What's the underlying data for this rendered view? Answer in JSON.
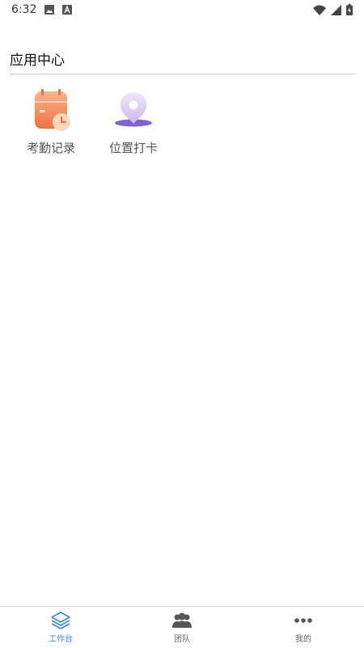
{
  "status_bar": {
    "time": "6:32",
    "left_icons": [
      "image-icon",
      "a-letter-icon"
    ],
    "right_icons": [
      "wifi-icon",
      "signal-icon",
      "battery-charging-icon"
    ]
  },
  "app_center": {
    "title": "应用中心",
    "apps": [
      {
        "label": "考勤记录",
        "icon": "attendance-calendar-clock-icon"
      },
      {
        "label": "位置打卡",
        "icon": "location-pin-icon"
      }
    ]
  },
  "bottom_nav": {
    "active": 0,
    "accent_color": "#3a86e8",
    "items": [
      {
        "label": "工作台",
        "icon": "layers-icon"
      },
      {
        "label": "团队",
        "icon": "team-icon"
      },
      {
        "label": "我的",
        "icon": "more-dots-icon"
      }
    ]
  }
}
